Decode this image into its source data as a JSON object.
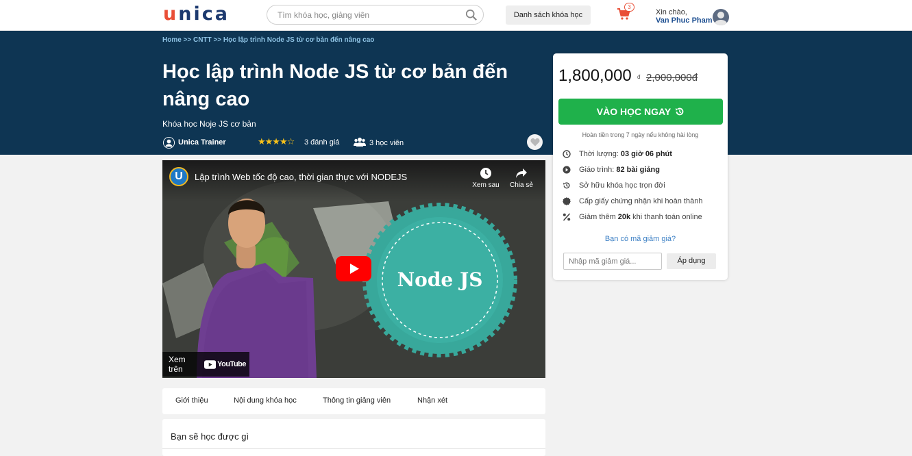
{
  "header": {
    "logo": {
      "u": "u",
      "rest": "nica"
    },
    "search_placeholder": "Tìm khóa học, giảng viên",
    "courses_button": "Danh sách khóa học",
    "cart_count": "3",
    "greeting": "Xin chào,",
    "user_name": "Van Phuc Pham"
  },
  "banner": {
    "breadcrumb": "Home >> CNTT >> Học lập trình Node JS từ cơ bản đến nâng cao",
    "title": "Học lập trình Node JS từ cơ bản đến nâng cao",
    "subtitle": "Khóa học Noje JS cơ bản",
    "trainer": "Unica Trainer",
    "stars": "★★★★☆",
    "rating_value": 4,
    "reviews": "3 đánh giá",
    "students": "3 học viên"
  },
  "video": {
    "title": "Lập trình Web tốc độ cao, thời gian thực với NODEJS",
    "channel_initial": "U",
    "watch_later": "Xem sau",
    "share": "Chia sẻ",
    "watch_on": "Xem trên",
    "youtube": "YouTube",
    "thumb_text": "Node JS"
  },
  "tabs": [
    "Giới thiệu",
    "Nội dung khóa học",
    "Thông tin giảng viên",
    "Nhận xét"
  ],
  "learn": {
    "title": "Bạn sẽ học được gì"
  },
  "card": {
    "price": "1,800,000",
    "currency": "đ",
    "old_price": "2,000,000đ",
    "cta": "VÀO HỌC NGAY",
    "refund": "Hoàn tiền trong 7 ngày nếu không hài lòng",
    "features": [
      {
        "icon": "clock-icon",
        "text": "Thời lượng:",
        "value": "03 giờ 06 phút"
      },
      {
        "icon": "play-circle-icon",
        "text": "Giáo trình:",
        "value": "82 bài giảng"
      },
      {
        "icon": "history-icon",
        "text": "Sở hữu khóa học trọn đời",
        "value": ""
      },
      {
        "icon": "certificate-icon",
        "text": "Cấp giấy chứng nhận khi hoàn thành",
        "value": ""
      },
      {
        "icon": "percent-icon",
        "text": "Giảm thêm",
        "value": "20k",
        "suffix": "khi thanh toán online"
      }
    ],
    "coupon_link": "Bạn có mã giảm giá?",
    "coupon_placeholder": "Nhập mã giảm giá...",
    "apply": "Áp dụng"
  },
  "colors": {
    "navy": "#0e3553",
    "green": "#1fb14b",
    "logo_orange": "#e94f37",
    "logo_navy": "#1d3a6f",
    "link_blue": "#3b7fc4"
  }
}
